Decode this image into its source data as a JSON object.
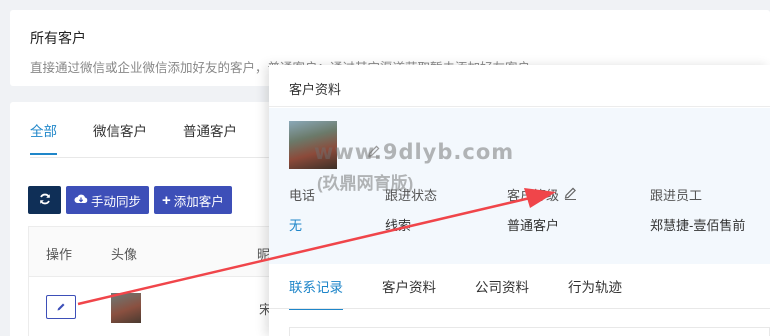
{
  "header": {
    "title": "所有客户",
    "desc": "直接通过微信或企业微信添加好友的客户，普通客户：通过其它渠道获取暂未添加好友客户"
  },
  "tabs": [
    "全部",
    "微信客户",
    "普通客户"
  ],
  "toolbar": {
    "refresh_icon": "refresh-icon",
    "sync_label": "手动同步",
    "add_label": "添加客户"
  },
  "table": {
    "columns": [
      "操作",
      "头像",
      "昵"
    ],
    "row_name": "宋元"
  },
  "drawer": {
    "title": "客户资料",
    "fields": [
      {
        "label": "电话",
        "value": "无"
      },
      {
        "label": "跟进状态",
        "value": "线索"
      },
      {
        "label": "客户等级",
        "value": "普通客户"
      },
      {
        "label": "跟进员工",
        "value": "郑慧捷-壹佰售前"
      }
    ],
    "watermark": "www.9dlyb.com",
    "watermark_sub": "(玖鼎网育版)",
    "tabs": [
      "联系记录",
      "客户资料",
      "公司资料",
      "行为轨迹"
    ]
  },
  "colors": {
    "accent": "#1f86c9",
    "button": "#3d4fb8",
    "arrow": "#f0454a"
  }
}
